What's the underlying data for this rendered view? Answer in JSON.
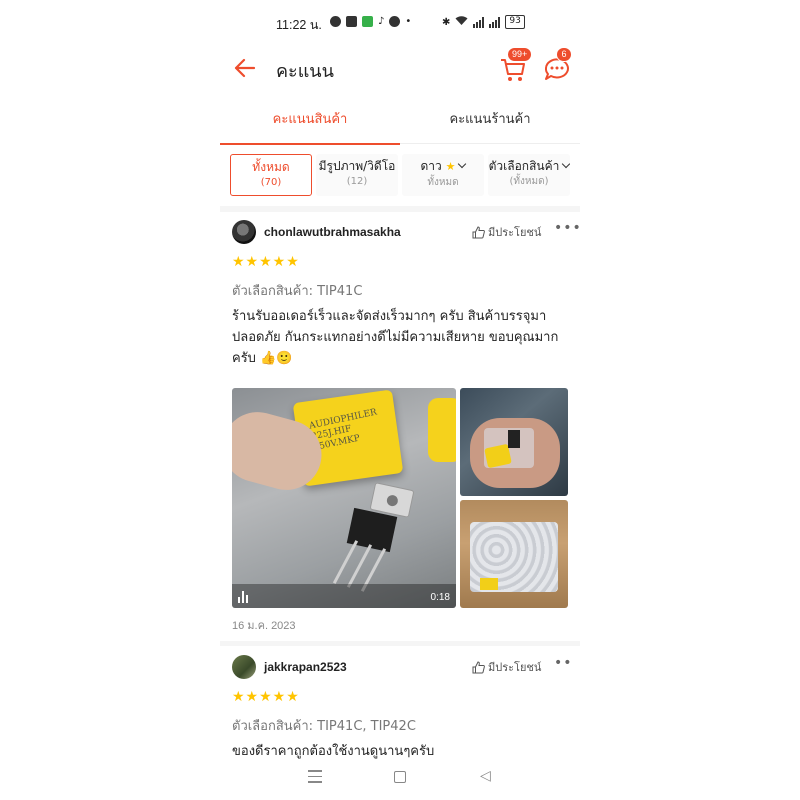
{
  "status_bar": {
    "time": "11:22 น.",
    "battery": "93"
  },
  "app_bar": {
    "title": "คะแนน",
    "cart_badge": "99+",
    "chat_badge": "6"
  },
  "tabs": [
    {
      "label": "คะแนนสินค้า",
      "active": true
    },
    {
      "label": "คะแนนร้านค้า",
      "active": false
    }
  ],
  "filters": [
    {
      "label": "ทั้งหมด",
      "sub": "(70)",
      "active": true
    },
    {
      "label": "มีรูปภาพ/วิดีโอ",
      "sub": "(12)",
      "active": false
    },
    {
      "label": "ดาว",
      "sub": "ทั้งหมด",
      "active": false
    },
    {
      "label": "ตัวเลือกสินค้า",
      "sub": "(ทั้งหมด)",
      "active": false
    }
  ],
  "reviews": [
    {
      "username": "chonlawutbrahmasakha",
      "helpful_label": "มีประโยชน์",
      "rating": 5,
      "stars": "★★★★★",
      "variant": "ตัวเลือกสินค้า: TIP41C",
      "comment": "ร้านรับออเดอร์เร็วและจัดส่งเร็วมากๆ ครับ สินค้าบรรจุมาปลอดภัย กันกระแทกอย่างดีไม่มีความเสียหาย ขอบคุณมากครับ 👍🙂",
      "video_duration": "0:18",
      "video_cap_text": "AUDIOPHILER\n225J.HIF\n250V.MKP",
      "date": "16 ม.ค. 2023"
    },
    {
      "username": "jakkrapan2523",
      "helpful_label": "มีประโยชน์",
      "rating": 5,
      "stars": "★★★★★",
      "variant": "ตัวเลือกสินค้า: TIP41C, TIP42C",
      "comment": "ของดีราคาถูกต้องใช้งานดูนานๆครับ"
    }
  ],
  "icons": {
    "back": "arrow-left-icon",
    "cart": "cart-icon",
    "chat": "chat-icon",
    "thumbs_up": "thumbs-up-icon",
    "more": "more-icon"
  },
  "colors": {
    "accent": "#ee4d2d",
    "star": "#ffc400"
  }
}
